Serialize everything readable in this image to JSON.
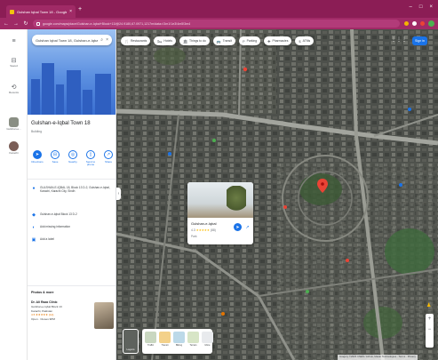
{
  "browser": {
    "tab_title": "Gulshan Iqbal Town 18 - Google",
    "tab_close": "×",
    "new_tab": "+",
    "url": "google.com/maps/place/Gulshan-e-Iqbal+Block+13/@24.9180,67.0971,1217m/data=!3m1!1e3!4m5!3m4",
    "window_controls": [
      "–",
      "□",
      "×"
    ],
    "nav": {
      "back": "←",
      "forward": "→",
      "reload": "↻"
    }
  },
  "rail": {
    "menu_glyph": "≡",
    "items": [
      {
        "glyph": "⊟",
        "label": "Saved"
      },
      {
        "glyph": "⟲",
        "label": "Recents"
      }
    ],
    "recent_labels": [
      "Gulshan-e...",
      "Karachi"
    ]
  },
  "panel": {
    "search_value": "Gulshan Iqbal Town 18, Gulshan-e-Iqbal, Karachi",
    "place_title": "Gulshan-e-Iqbal Town 18",
    "place_subtitle": "Building",
    "actions": [
      {
        "label": "Directions",
        "glyph": "➤",
        "primary": true
      },
      {
        "label": "Save",
        "glyph": "⊟",
        "primary": false
      },
      {
        "label": "Nearby",
        "glyph": "◎",
        "primary": false
      },
      {
        "label": "Send to phone",
        "glyph": "▯",
        "primary": false
      },
      {
        "label": "Share",
        "glyph": "↗",
        "primary": false
      }
    ],
    "info_rows": [
      {
        "glyph": "●",
        "text": "GULSHAN-E-IQBAL 18, Block 13 D-2, Gulshan-e-Iqbal, Karachi, Karachi City, Sindh"
      },
      {
        "glyph": "◆",
        "text": "Gulshan-e-Iqbal Block 13 D-2"
      },
      {
        "glyph": "◐",
        "text": "Add missing information"
      },
      {
        "glyph": "▣",
        "text": "Add a label"
      }
    ],
    "section_head": "Photos & more",
    "listing": {
      "name": "Dr. Ali Raza Clinic",
      "line1": "Gulshan-e-Iqbal Block 13",
      "line2": "Karachi, Pakistan",
      "rating": "4.5 ★★★★★ (12)",
      "line3": "Open · Closes 9PM"
    }
  },
  "map": {
    "chips": [
      {
        "glyph": "🍴",
        "label": "Restaurants"
      },
      {
        "glyph": "🛏",
        "label": "Hotels"
      },
      {
        "glyph": "🏛",
        "label": "Things to do"
      },
      {
        "glyph": "🚌",
        "label": "Transit"
      },
      {
        "glyph": "P",
        "label": "Parking"
      },
      {
        "glyph": "✚",
        "label": "Pharmacies"
      },
      {
        "glyph": "$",
        "label": "ATMs"
      }
    ],
    "apps_glyph": "⋮⋮⋮",
    "signin_label": "Sign in",
    "popup": {
      "title": "Gulshan-e-Iqbal",
      "rating_value": "4.3",
      "stars": "★★★★★",
      "reviews": "(88)",
      "meta": "Park",
      "dir_glyph": "➤",
      "share_glyph": "↗"
    },
    "layer_tile_label": "Layers",
    "layer_options": [
      {
        "label": "Traffic",
        "color": "#c9d7c0"
      },
      {
        "label": "Transit",
        "color": "#f3d18a"
      },
      {
        "label": "Biking",
        "color": "#bcd9e8"
      },
      {
        "label": "Terrain",
        "color": "#d7e5c6"
      },
      {
        "label": "More",
        "color": "#e8eaed"
      }
    ],
    "zoom_in": "+",
    "zoom_out": "−",
    "pegman_glyph": "♟",
    "copyright": "Imagery ©2023 CNES / Airbus, Maxar Technologies · Terms · Privacy"
  },
  "colors": {
    "chrome": "#8b1d55",
    "accent": "#1a73e8",
    "map_base": "#4a4d49",
    "road": "#a3a59e",
    "marker": "#ea4335"
  }
}
